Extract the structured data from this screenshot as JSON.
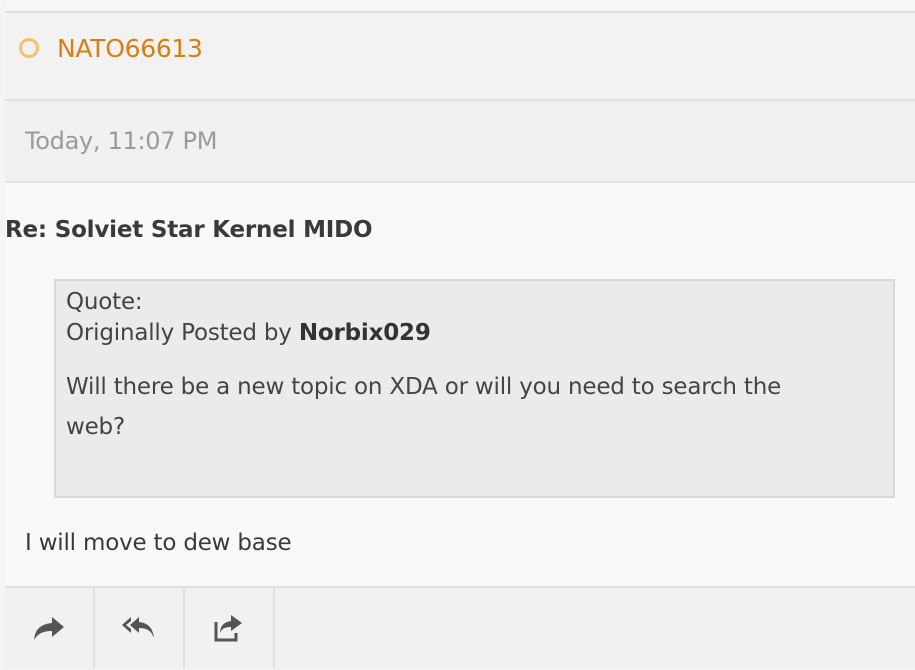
{
  "post": {
    "username": "NATO66613",
    "date": "Today, 11:07 PM",
    "title": "Re: Solviet Star Kernel MIDO",
    "quote": {
      "label": "Quote:",
      "originally_posted_by": "Originally Posted by",
      "author": "Norbix029",
      "text": "Will there be a new topic on XDA or will you need to search the web?"
    },
    "body": "I will move to dew base"
  },
  "actions": [
    {
      "icon": "share-arrow-icon"
    },
    {
      "icon": "reply-all-icon"
    },
    {
      "icon": "external-share-icon"
    }
  ],
  "colors": {
    "username": "#d87e14",
    "status_ring": "#f5c26b",
    "date": "#9a9a9a",
    "quote_bg": "#ebebeb",
    "icon": "#555555"
  }
}
